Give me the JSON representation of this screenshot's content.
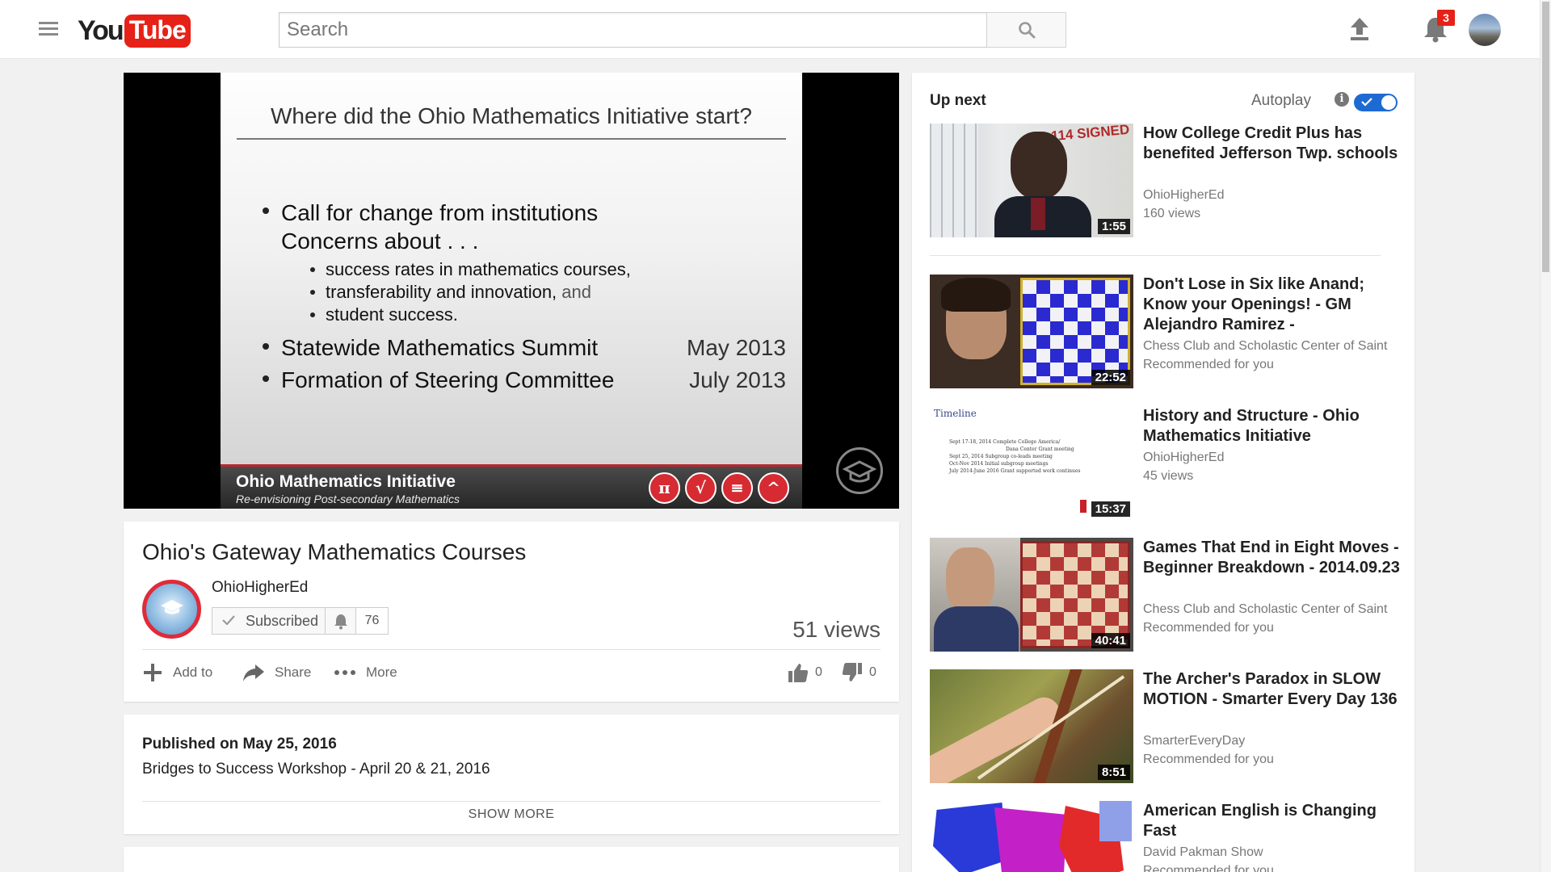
{
  "masthead": {
    "logo_you": "You",
    "logo_tube": "Tube",
    "search_placeholder": "Search",
    "notification_count": "3"
  },
  "player": {
    "slide": {
      "title": "Where did the Ohio Mathematics Initiative start?",
      "bullet1_line1": "Call for change from institutions",
      "bullet1_line2": "Concerns about . . .",
      "sub1": "success rates in mathematics courses,",
      "sub2_main": "transferability and innovation,",
      "sub2_tail": "and",
      "sub3": "student success.",
      "bullet2": "Statewide Mathematics Summit",
      "bullet2_date": "May 2013",
      "bullet3": "Formation of Steering Committee",
      "bullet3_date": "July 2013",
      "banner_title": "Ohio Mathematics Initiative",
      "banner_subtitle": "Re-envisioning Post-secondary Mathematics"
    }
  },
  "video": {
    "title": "Ohio's Gateway Mathematics Courses",
    "channel": "OhioHigherEd",
    "subscribe_label": "Subscribed",
    "subscriber_count": "76",
    "views": "51 views",
    "actions": {
      "add_to": "Add to",
      "share": "Share",
      "more": "More"
    },
    "likes": "0",
    "dislikes": "0"
  },
  "description": {
    "published": "Published on May 25, 2016",
    "text": "Bridges to Success Workshop - April 20 & 21, 2016",
    "show_more": "SHOW MORE"
  },
  "sidebar": {
    "up_next": "Up next",
    "autoplay_label": "Autoplay",
    "autoplay_on": true,
    "items": [
      {
        "title": "How College Credit Plus has benefited Jefferson Twp. schools",
        "channel": "OhioHigherEd",
        "meta": "160 views",
        "duration": "1:55",
        "thumb": "interview-sign"
      },
      {
        "title": "Don't Lose in Six like Anand; Know your Openings! - GM Alejandro Ramirez -",
        "channel": "Chess Club and Scholastic Center of Saint",
        "meta": "Recommended for you",
        "duration": "22:52",
        "thumb": "chess-blue"
      },
      {
        "title": "History and Structure - Ohio Mathematics Initiative",
        "channel": "OhioHigherEd",
        "meta": "45 views",
        "duration": "15:37",
        "thumb": "timeline-slide"
      },
      {
        "title": "Games That End in Eight Moves - Beginner Breakdown - 2014.09.23",
        "channel": "Chess Club and Scholastic Center of Saint",
        "meta": "Recommended for you",
        "duration": "40:41",
        "thumb": "chess-red"
      },
      {
        "title": "The Archer's Paradox in SLOW MOTION - Smarter Every Day 136",
        "channel": "SmarterEveryDay",
        "meta": "Recommended for you",
        "duration": "8:51",
        "thumb": "arrow-slowmo"
      },
      {
        "title": "American English is Changing Fast",
        "channel": "David Pakman Show",
        "meta": "Recommended for you",
        "duration": "",
        "thumb": "us-map"
      }
    ],
    "timeline_thumb": {
      "heading": "Timeline",
      "rows": [
        "Sept 17-18, 2014  Complete College America/",
        "Dana Center Grant meeting",
        "Sept 25, 2014  Subgroup co-leads meeting",
        "Oct-Nov 2014  Initial subgroup meetings",
        "July 2014-June 2016  Grant supported work continues"
      ]
    },
    "sign_text": "114 SIGNED"
  },
  "colors": {
    "brand_red": "#e62117",
    "toggle_blue": "#1e6ad3",
    "page_bg": "#f1f1f1",
    "slide_accent": "#d62b32"
  }
}
